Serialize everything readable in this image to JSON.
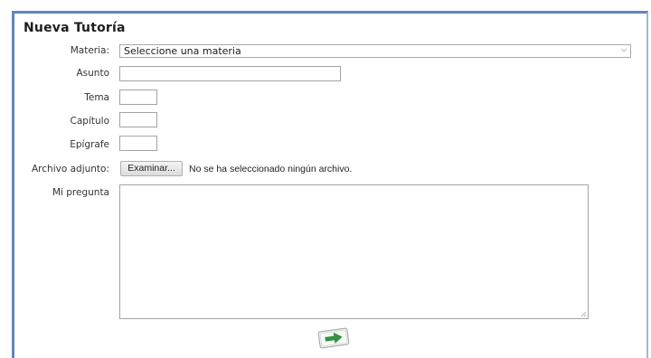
{
  "form": {
    "title": "Nueva Tutoría",
    "materia_label": "Materia:",
    "materia_value": "Seleccione una materia",
    "asunto_label": "Asunto",
    "tema_label": "Tema",
    "capitulo_label": "Capítulo",
    "epigrafe_label": "Epígrafe",
    "archivo_label": "Archivo adjunto:",
    "examinar_label": "Examinar...",
    "archivo_status": "No se ha seleccionado ningún archivo.",
    "pregunta_label": "Mi pregunta"
  },
  "icons": {
    "submit": "send-arrow-icon",
    "dropdown": "chevron-down-icon"
  },
  "colors": {
    "frame_border": "#5f86c6",
    "submit_arrow": "#2e9a3a"
  }
}
